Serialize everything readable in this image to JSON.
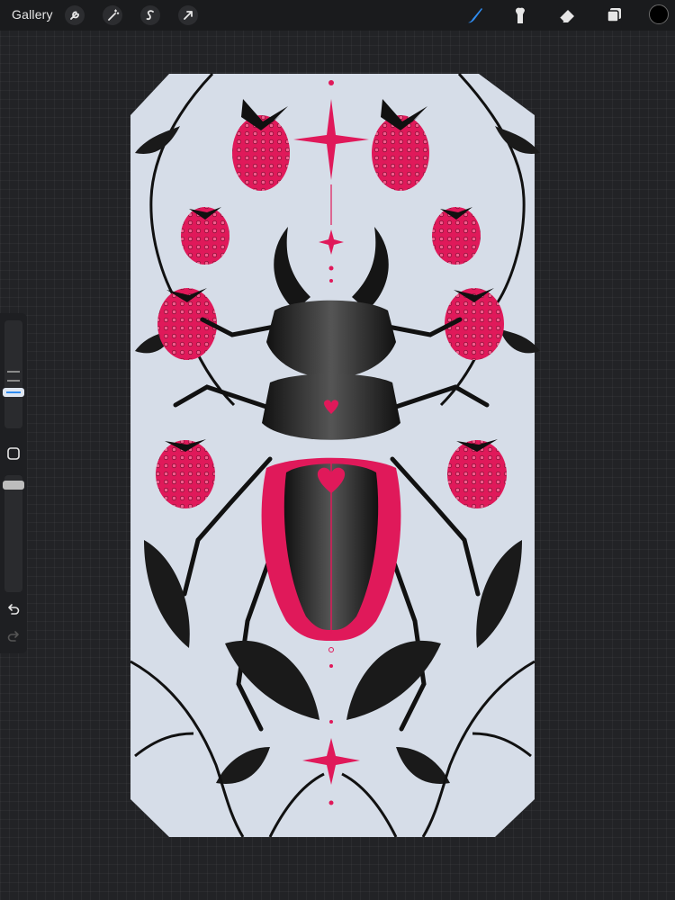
{
  "topbar": {
    "gallery_label": "Gallery",
    "tools_left": [
      {
        "name": "actions",
        "icon": "wrench-icon"
      },
      {
        "name": "adjustments",
        "icon": "magic-wand-icon"
      },
      {
        "name": "selection",
        "icon": "selection-s-icon"
      },
      {
        "name": "transform",
        "icon": "arrow-cursor-icon"
      }
    ],
    "tools_right": [
      {
        "name": "brush",
        "icon": "brush-icon",
        "active": true
      },
      {
        "name": "smudge",
        "icon": "smudge-finger-icon",
        "active": false
      },
      {
        "name": "eraser",
        "icon": "eraser-icon",
        "active": false
      },
      {
        "name": "layers",
        "icon": "layers-icon",
        "active": false
      }
    ],
    "current_color": "#000000"
  },
  "sidebar": {
    "brush_size_slider_icon": "size-slider",
    "opacity_slider_icon": "opacity-slider",
    "modify_button_icon": "square-icon",
    "undo_icon": "undo-arrow-icon",
    "redo_icon": "redo-arrow-icon"
  },
  "artwork": {
    "subject": "stag-beetle-with-raspberries",
    "paper_color": "#d6dde8",
    "ink_color": "#111111",
    "accent_color": "#e0195a"
  },
  "colors": {
    "active_tool": "#2f8cf0",
    "toolbar_bg": "#1a1b1d",
    "canvas_bg": "#222326"
  }
}
